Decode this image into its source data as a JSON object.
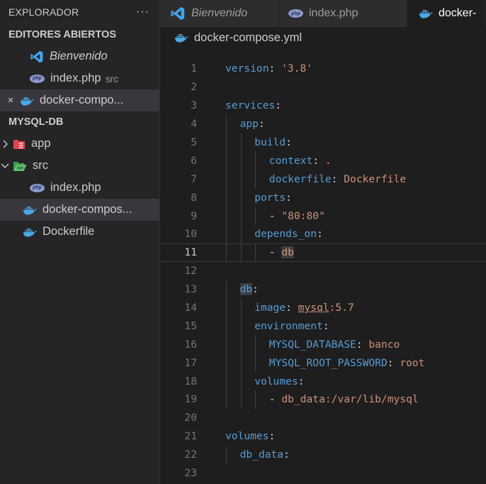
{
  "explorer": {
    "title": "EXPLORADOR",
    "menu_glyph": "···",
    "open_editors": {
      "heading": "EDITORES ABIERTOS",
      "items": [
        {
          "label": "Bienvenido",
          "icon": "vscode-icon",
          "detail": ""
        },
        {
          "label": "index.php",
          "icon": "php-icon",
          "detail": "src"
        },
        {
          "label": "docker-compo...",
          "icon": "docker-icon",
          "detail": ""
        }
      ]
    },
    "project": {
      "heading": "MYSQL-DB",
      "items": [
        {
          "label": "app",
          "icon": "folder-icon"
        },
        {
          "label": "src",
          "icon": "folder-open-icon"
        },
        {
          "label": "index.php",
          "icon": "php-icon"
        },
        {
          "label": "docker-compos...",
          "icon": "docker-icon"
        },
        {
          "label": "Dockerfile",
          "icon": "docker-icon"
        }
      ]
    }
  },
  "tabs": [
    {
      "label": "Bienvenido",
      "icon": "vscode-icon"
    },
    {
      "label": "index.php",
      "icon": "php-icon"
    },
    {
      "label": "docker-",
      "icon": "docker-icon"
    }
  ],
  "php_badge": "php",
  "breadcrumb": "docker-compose.yml",
  "editor": {
    "current_line": 11,
    "lines": [
      {
        "n": "1",
        "t": [
          "version",
          ": ",
          "'3.8'"
        ]
      },
      {
        "n": "2"
      },
      {
        "n": "3",
        "t": [
          "services",
          ":"
        ]
      },
      {
        "n": "4",
        "t": [
          "app",
          ":"
        ]
      },
      {
        "n": "5",
        "t": [
          "build",
          ":"
        ]
      },
      {
        "n": "6",
        "t": [
          "context",
          ": ",
          "."
        ]
      },
      {
        "n": "7",
        "t": [
          "dockerfile",
          ": ",
          "Dockerfile"
        ]
      },
      {
        "n": "8",
        "t": [
          "ports",
          ":"
        ]
      },
      {
        "n": "9",
        "t": [
          "- ",
          "\"80:80\""
        ]
      },
      {
        "n": "10",
        "t": [
          "depends_on",
          ":"
        ]
      },
      {
        "n": "11",
        "t": [
          "- ",
          "db"
        ]
      },
      {
        "n": "12"
      },
      {
        "n": "13",
        "t": [
          "db",
          ":"
        ]
      },
      {
        "n": "14",
        "t": [
          "image",
          ": ",
          "mysql",
          ":5.7"
        ]
      },
      {
        "n": "15",
        "t": [
          "environment",
          ":"
        ]
      },
      {
        "n": "16",
        "t": [
          "MYSQL_DATABASE",
          ": ",
          "banco"
        ]
      },
      {
        "n": "17",
        "t": [
          "MYSQL_ROOT_PASSWORD",
          ": ",
          "root"
        ]
      },
      {
        "n": "18",
        "t": [
          "volumes",
          ":"
        ]
      },
      {
        "n": "19",
        "t": [
          "- ",
          "db_data:/var/lib/mysql"
        ]
      },
      {
        "n": "20"
      },
      {
        "n": "21",
        "t": [
          "volumes",
          ":"
        ]
      },
      {
        "n": "22",
        "t": [
          "db_data",
          ":"
        ]
      },
      {
        "n": "23"
      }
    ]
  },
  "colors": {
    "keyword": "#569cd6",
    "string": "#ce9178",
    "background": "#1e1e1e",
    "sidebar": "#252526"
  }
}
